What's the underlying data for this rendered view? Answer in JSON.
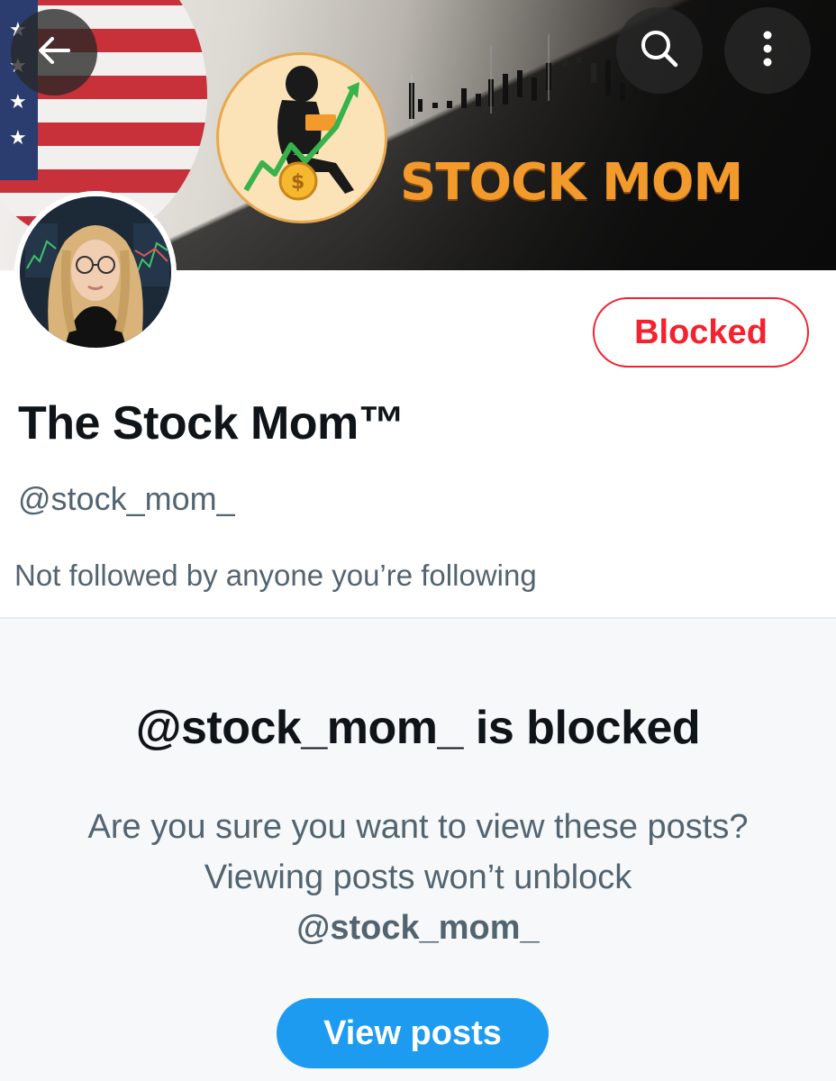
{
  "header": {
    "back_icon": "arrow-left-icon",
    "search_icon": "search-icon",
    "more_icon": "more-vertical-icon",
    "banner_text": "STOCK MOM"
  },
  "profile": {
    "display_name": "The Stock Mom™",
    "handle": "@stock_mom_",
    "followed_by": "Not followed by anyone you’re following",
    "blocked_button_label": "Blocked"
  },
  "blocked_notice": {
    "title": "@stock_mom_ is blocked",
    "description_part1": "Are you sure you want to view these posts? Viewing posts won’t unblock",
    "description_handle": "@stock_mom_",
    "view_posts_label": "View posts"
  },
  "colors": {
    "blocked_red": "#f4212e",
    "primary_blue": "#1d9bf0",
    "secondary_text": "#536471",
    "logo_orange": "#f29a2c"
  }
}
